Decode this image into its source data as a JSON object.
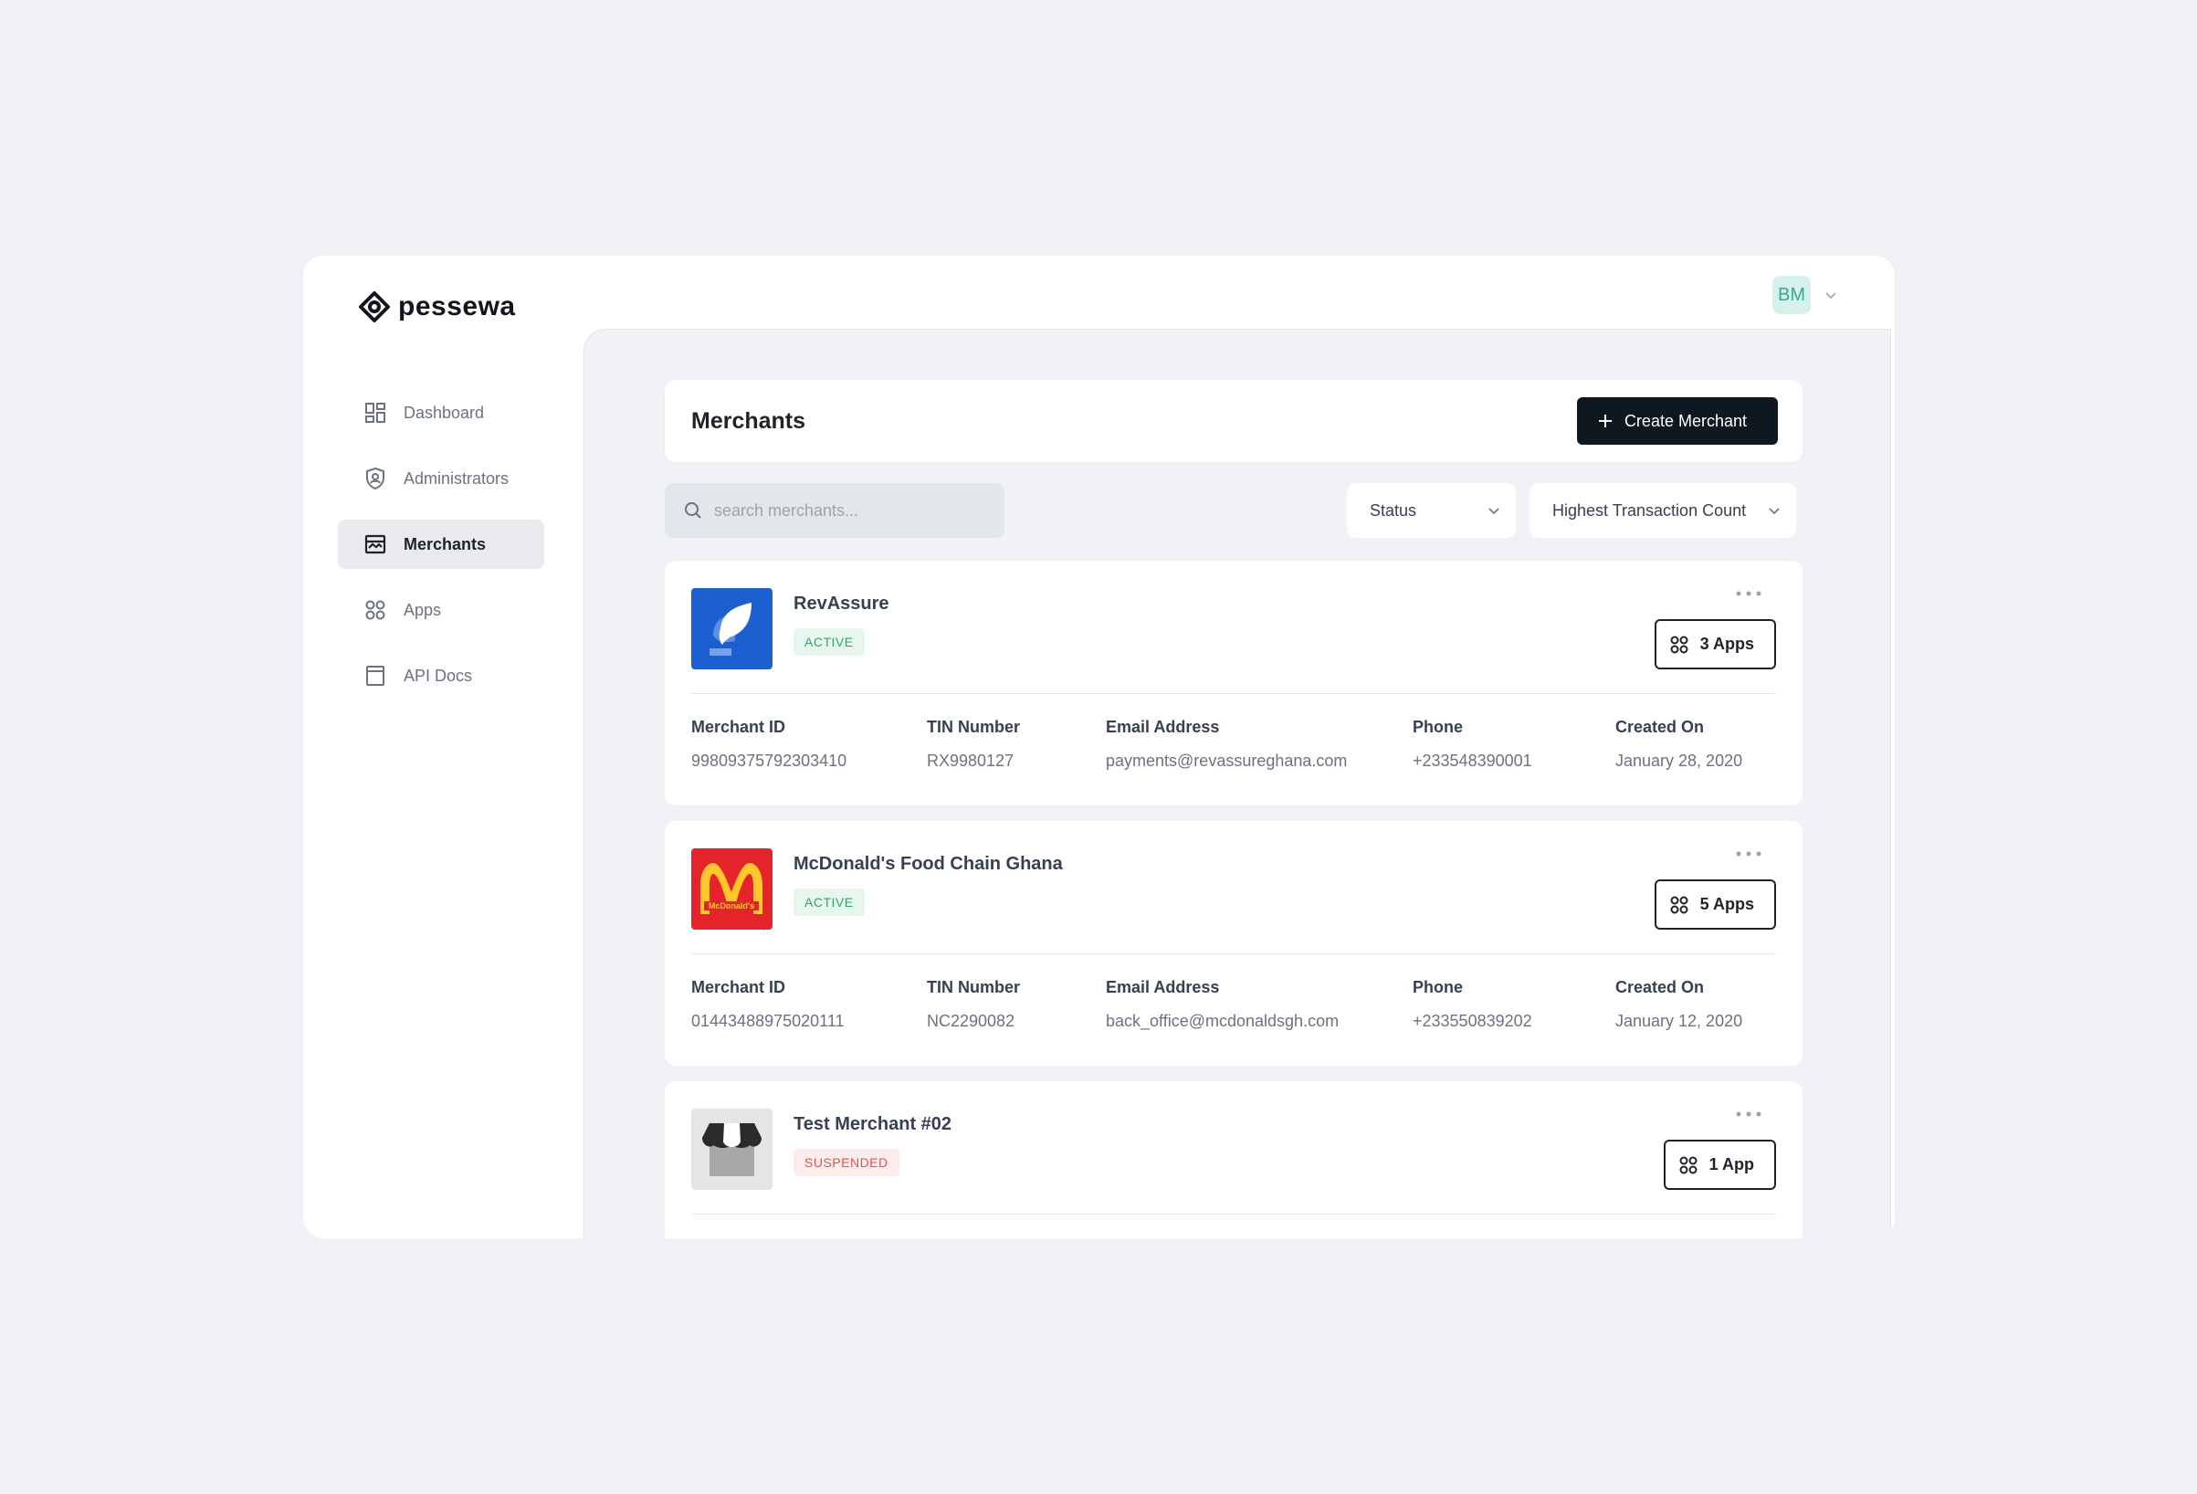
{
  "brand": {
    "name": "pessewa"
  },
  "user": {
    "initials": "BM"
  },
  "sidebar": {
    "items": [
      {
        "label": "Dashboard",
        "icon": "dashboard-icon"
      },
      {
        "label": "Administrators",
        "icon": "shield-user-icon"
      },
      {
        "label": "Merchants",
        "icon": "storefront-icon",
        "active": true
      },
      {
        "label": "Apps",
        "icon": "apps-grid-icon"
      },
      {
        "label": "API Docs",
        "icon": "document-icon"
      }
    ]
  },
  "header": {
    "title": "Merchants",
    "create_label": "Create Merchant"
  },
  "search": {
    "placeholder": "search merchants..."
  },
  "filters": {
    "status_label": "Status",
    "sort_label": "Highest Transaction Count"
  },
  "field_labels": {
    "merchant_id": "Merchant ID",
    "tin": "TIN Number",
    "email": "Email Address",
    "phone": "Phone",
    "created": "Created On"
  },
  "merchants": [
    {
      "name": "RevAssure",
      "status": "ACTIVE",
      "apps_label": "3 Apps",
      "merchant_id": "99809375792303410",
      "tin": "RX9980127",
      "email": "payments@revassureghana.com",
      "phone": "+233548390001",
      "created": "January 28, 2020"
    },
    {
      "name": "McDonald's Food Chain Ghana",
      "status": "ACTIVE",
      "apps_label": "5 Apps",
      "merchant_id": "01443488975020111",
      "tin": "NC2290082",
      "email": "back_office@mcdonaldsgh.com",
      "phone": "+233550839202",
      "created": "January 12, 2020"
    },
    {
      "name": "Test Merchant #02",
      "status": "SUSPENDED",
      "apps_label": "1 App"
    }
  ],
  "colors": {
    "accent_dark": "#0f1720",
    "active_green": "#38a169",
    "suspended_red": "#e05252",
    "avatar_bg": "#d6f1ec"
  }
}
